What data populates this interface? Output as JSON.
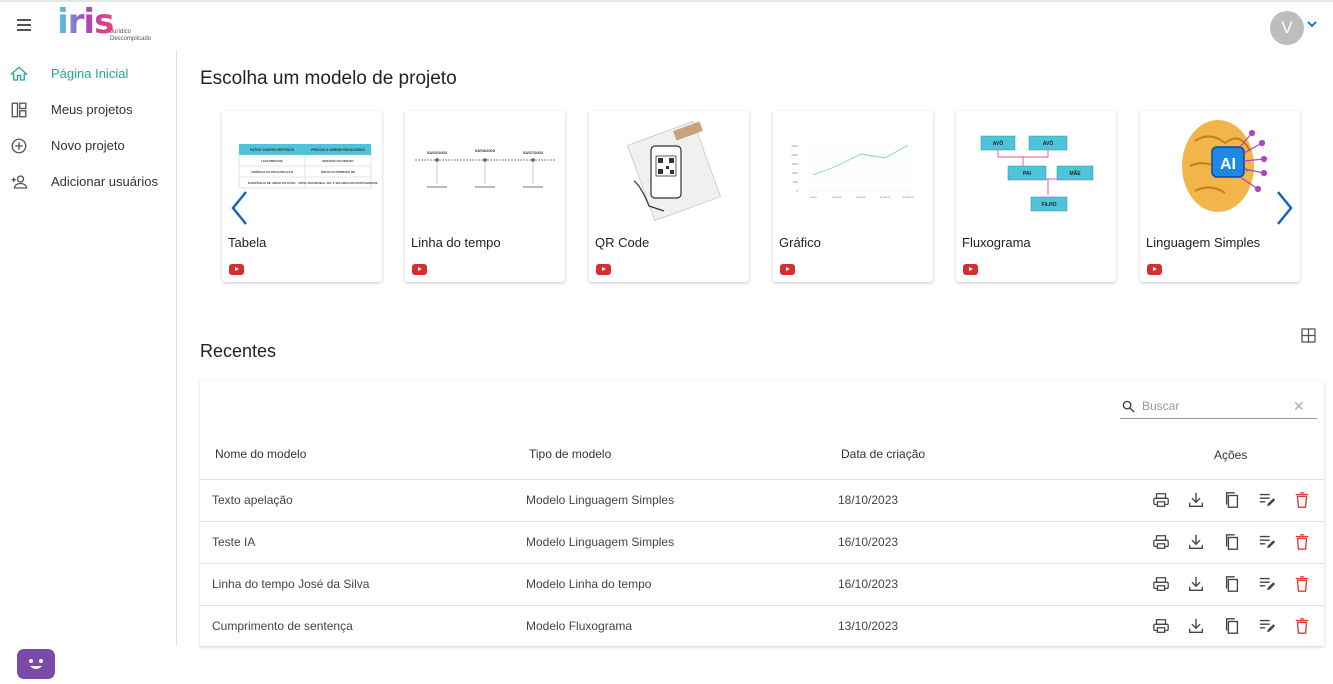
{
  "app": {
    "logo_text": "iris",
    "logo_subtitle": "Jurídico Descomplicado",
    "user_initial": "V"
  },
  "sidebar": {
    "items": [
      {
        "label": "Página Inicial",
        "icon": "home-icon",
        "active": true
      },
      {
        "label": "Meus projetos",
        "icon": "dashboard-icon",
        "active": false
      },
      {
        "label": "Novo projeto",
        "icon": "add-circle-icon",
        "active": false
      },
      {
        "label": "Adicionar usuários",
        "icon": "person-add-icon",
        "active": false
      }
    ]
  },
  "main": {
    "title": "Escolha um modelo de projeto",
    "templates": [
      {
        "label": "Tabela",
        "thumb": "table-thumbnail"
      },
      {
        "label": "Linha do tempo",
        "thumb": "timeline-thumbnail"
      },
      {
        "label": "QR Code",
        "thumb": "qr-code-thumbnail"
      },
      {
        "label": "Gráfico",
        "thumb": "chart-thumbnail"
      },
      {
        "label": "Fluxograma",
        "thumb": "flowchart-thumbnail"
      },
      {
        "label": "Linguagem Simples",
        "thumb": "ai-brain-thumbnail"
      }
    ]
  },
  "thumbs": {
    "table": {
      "headers": [
        "FATOS CONTROVERTIDOS",
        "PROVAS A SEREM PRODUZIDAS"
      ],
      "rows": [
        [
          "LEGITIMIDADE",
          "MATÉRIA DE DIREITO"
        ],
        [
          "VIGÊNCIA DA PROCURAÇÃO",
          "ÔNUS DA PRIMEIRA RÉ"
        ],
        [
          "EXISTÊNCIA DE UNIÃO ESTÁVEL",
          "PROVA TESTEMUNHAL, ART. X, SER ARROLADO OPORTUNAMENTE"
        ]
      ]
    },
    "timeline": {
      "dates": [
        "03/02/2003",
        "03/03/2003",
        "03/07/2003"
      ]
    },
    "chart": {
      "y_ticks": [
        "2500",
        "2000",
        "1500",
        "1000",
        "500",
        "0"
      ],
      "x_ticks": [
        "1 ano",
        "6 anos",
        "8 anos",
        "12 anos",
        "15 anos"
      ]
    },
    "flowchart": {
      "boxes": [
        "AVÔ",
        "AVÓ",
        "PAI",
        "MÃE",
        "FILHO"
      ]
    },
    "ai_label": "AI"
  },
  "recent": {
    "title": "Recentes",
    "search_placeholder": "Buscar",
    "columns": [
      "Nome do modelo",
      "Tipo de modelo",
      "Data de criação",
      "Ações"
    ],
    "rows": [
      {
        "name": "Texto apelação",
        "type": "Modelo Linguagem Simples",
        "date": "18/10/2023"
      },
      {
        "name": "Teste IA",
        "type": "Modelo Linguagem Simples",
        "date": "16/10/2023"
      },
      {
        "name": "Linha do tempo José da Silva",
        "type": "Modelo Linha do tempo",
        "date": "16/10/2023"
      },
      {
        "name": "Cumprimento de sentença",
        "type": "Modelo Fluxograma",
        "date": "13/10/2023"
      }
    ],
    "actions": [
      "print-icon",
      "download-icon",
      "copy-icon",
      "edit-icon",
      "delete-icon"
    ]
  },
  "colors": {
    "accent": "#26a69a",
    "arrow": "#1565c0",
    "delete": "#e53935",
    "youtube": "#d32f2f",
    "chatbot": "#7b4aa8"
  }
}
